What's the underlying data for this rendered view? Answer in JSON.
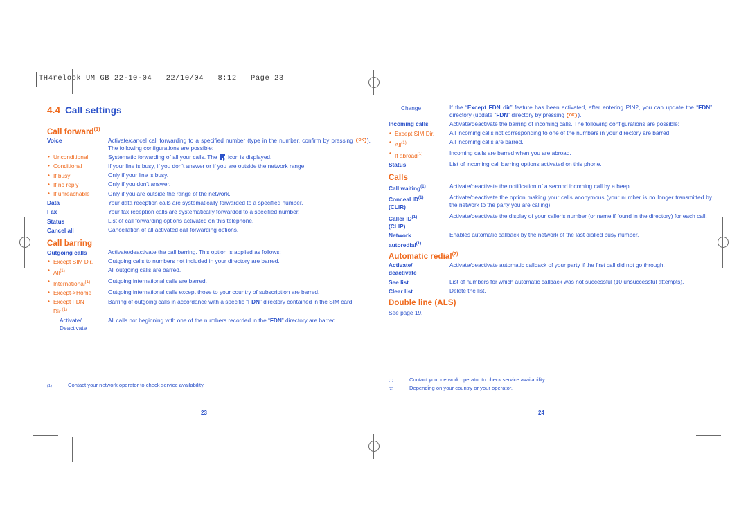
{
  "slug": "TH4relook_UM_GB_22-10-04   22/10/04   8:12   Page 23",
  "colors": {
    "blue": "#2c52c9",
    "orange": "#ef6a1e",
    "mark_gray": "#6b6b6b"
  },
  "left_page": {
    "folio": "23",
    "chapter": {
      "number": "4.4",
      "title": "Call settings"
    },
    "sections": [
      {
        "heading": "Call forward",
        "heading_sup": "(1)",
        "rows": [
          {
            "type": "term",
            "term": "Voice",
            "desc_html": "Activate/cancel call forwarding to a specified number (type in the number, confirm by pressing <<OK>>). The following configurations are possible:",
            "desc_plain": "Activate/cancel call forwarding to a specified number (type in the number, confirm by pressing OK). The following configurations are possible:"
          },
          {
            "type": "sub",
            "term": "Unconditional",
            "desc_plain": "Systematic forwarding of all your calls. The [call-forward] icon is displayed."
          },
          {
            "type": "sub",
            "term": "Conditional",
            "desc_plain": "If your line is busy, if you don't answer or if you are outside the network range."
          },
          {
            "type": "sub",
            "term": "If busy",
            "desc_plain": "Only if your line is busy."
          },
          {
            "type": "sub",
            "term": "If no reply",
            "desc_plain": "Only if you don't answer."
          },
          {
            "type": "sub",
            "term": "If unreachable",
            "desc_plain": "Only if you are outside the range of the network."
          },
          {
            "type": "term",
            "term": "Data",
            "desc_plain": "Your data reception calls are systematically forwarded to a specified number."
          },
          {
            "type": "term",
            "term": "Fax",
            "desc_plain": "Your fax reception calls are systematically forwarded to a specified number."
          },
          {
            "type": "term",
            "term": "Status",
            "desc_plain": "List of call forwarding options activated on this telephone."
          },
          {
            "type": "term",
            "term": "Cancel all",
            "desc_plain": "Cancellation of all activated call forwarding options."
          }
        ]
      },
      {
        "heading": "Call barring",
        "heading_sup": "",
        "rows": [
          {
            "type": "term",
            "term": "Outgoing calls",
            "desc_plain": "Activate/deactivate the call barring. This option is applied as follows:"
          },
          {
            "type": "sub",
            "term": "Except SIM Dir.",
            "desc_plain": "Outgoing calls to numbers not included in your directory are barred."
          },
          {
            "type": "sub",
            "term": "All",
            "term_sup": "(1)",
            "desc_plain": "All outgoing calls are barred."
          },
          {
            "type": "sub",
            "term": "International",
            "term_sup": "(1)",
            "desc_plain": "Outgoing international calls are barred."
          },
          {
            "type": "sub",
            "term": "Except->Home",
            "desc_plain": "Outgoing international calls except those to your country of subscription are barred."
          },
          {
            "type": "sub",
            "term": "Except FDN Dir.",
            "term_sup": "(1)",
            "desc_plain": "Barring of outgoing calls in accordance with a specific \"FDN\" directory contained in the SIM card."
          },
          {
            "type": "subsub",
            "term": "Activate/ Deactivate",
            "desc_plain": "All calls not beginning with one of the numbers recorded in the \"FDN\" directory are barred."
          }
        ]
      }
    ],
    "footnotes": [
      {
        "mark": "(1)",
        "text": "Contact your network operator to check service availability."
      }
    ]
  },
  "right_page": {
    "folio": "24",
    "sections": [
      {
        "heading": "",
        "rows": [
          {
            "type": "plain",
            "term": "Change",
            "desc_plain": "If the \"Except FDN dir\" feature has been activated, after entering PIN2, you can update the \"FDN\" directory (update \"FDN\" directory by pressing OK)."
          },
          {
            "type": "term",
            "term": "Incoming calls",
            "desc_plain": "Activate/deactivate the barring of incoming calls. The following configurations are possible:"
          },
          {
            "type": "sub",
            "term": "Except SIM Dir.",
            "desc_plain": "All incoming calls not corresponding to one of the numbers in your directory are barred."
          },
          {
            "type": "sub",
            "term": "All",
            "term_sup": "(1)",
            "desc_plain": "All incoming calls are barred."
          },
          {
            "type": "sub",
            "term": "If abroad",
            "term_sup": "(1)",
            "desc_plain": "Incoming calls are barred when you are abroad."
          },
          {
            "type": "term",
            "term": "Status",
            "desc_plain": "List of incoming call barring options activated on this phone."
          }
        ]
      },
      {
        "heading": "Calls",
        "heading_sup": "",
        "rows": [
          {
            "type": "term",
            "term": "Call waiting",
            "term_sup": "(1)",
            "desc_plain": "Activate/deactivate the notification of a second incoming call by a beep."
          },
          {
            "type": "term",
            "term": "Conceal ID (CLIR)",
            "term_sup": "(1)",
            "desc_plain": "Activate/deactivate the option making your calls anonymous (your number is no longer transmitted by the network to the party you are calling)."
          },
          {
            "type": "term",
            "term": "Caller ID (CLIP)",
            "term_sup": "(1)",
            "desc_plain": "Activate/deactivate the display of your caller's number (or name if found in the directory) for each call."
          },
          {
            "type": "term",
            "term": "Network autoredial",
            "term_sup": "(1)",
            "desc_plain": "Enables automatic callback by the network of the last dialled busy number."
          }
        ]
      },
      {
        "heading": "Automatic redial",
        "heading_sup": "(2)",
        "rows": [
          {
            "type": "term",
            "term": "Activate/ deactivate",
            "desc_plain": "Activate/deactivate automatic callback of your party if the first call did not go through."
          },
          {
            "type": "term",
            "term": "See list",
            "desc_plain": "List of numbers for which automatic callback was not successful (10 unsuccessful attempts)."
          },
          {
            "type": "term",
            "term": "Clear list",
            "desc_plain": "Delete the list."
          }
        ]
      },
      {
        "heading": "Double line (ALS)",
        "heading_sup": "",
        "trailing_text": "See page 19."
      }
    ],
    "footnotes": [
      {
        "mark": "(1)",
        "text": "Contact your network operator to check service availability."
      },
      {
        "mark": "(2)",
        "text": "Depending on your country or your operator."
      }
    ]
  }
}
